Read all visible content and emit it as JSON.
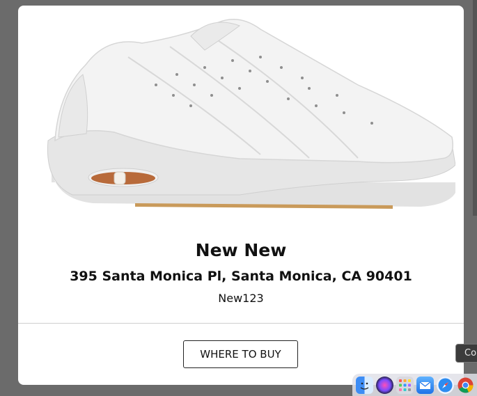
{
  "product": {
    "image_icon": "sneaker-image",
    "image_colors": {
      "upper": "#f2f2f2",
      "midsole": "#e4e4e4",
      "air_unit": "#b86a3a",
      "outsole": "#c99a5a"
    }
  },
  "store": {
    "name": "New New",
    "address": "395 Santa Monica Pl, Santa Monica, CA 90401",
    "code": "New123"
  },
  "actions": {
    "where_to_buy_label": "WHERE TO BUY"
  },
  "tooltip": {
    "text": "Co"
  },
  "dock": {
    "apps": [
      {
        "name": "finder-icon"
      },
      {
        "name": "siri-icon"
      },
      {
        "name": "launchpad-icon"
      },
      {
        "name": "mail-icon"
      },
      {
        "name": "safari-icon"
      },
      {
        "name": "chrome-icon"
      }
    ]
  },
  "colors": {
    "backdrop": "#6b6b6b",
    "modal": "#ffffff",
    "text": "#111111",
    "divider": "#cfcfcf"
  }
}
